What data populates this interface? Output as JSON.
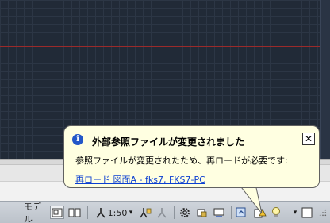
{
  "balloon": {
    "title": "外部参照ファイルが変更されました",
    "message": "参照ファイルが変更されたため、再ロードが必要です:",
    "link": "再ロード 図面A - fks7, FKS7-PC",
    "close_glyph": "✕"
  },
  "statusbar": {
    "model_label": "モデル",
    "scale_label": "1:50",
    "scale_dropdown": "▾",
    "menu_arrow": "▾"
  }
}
